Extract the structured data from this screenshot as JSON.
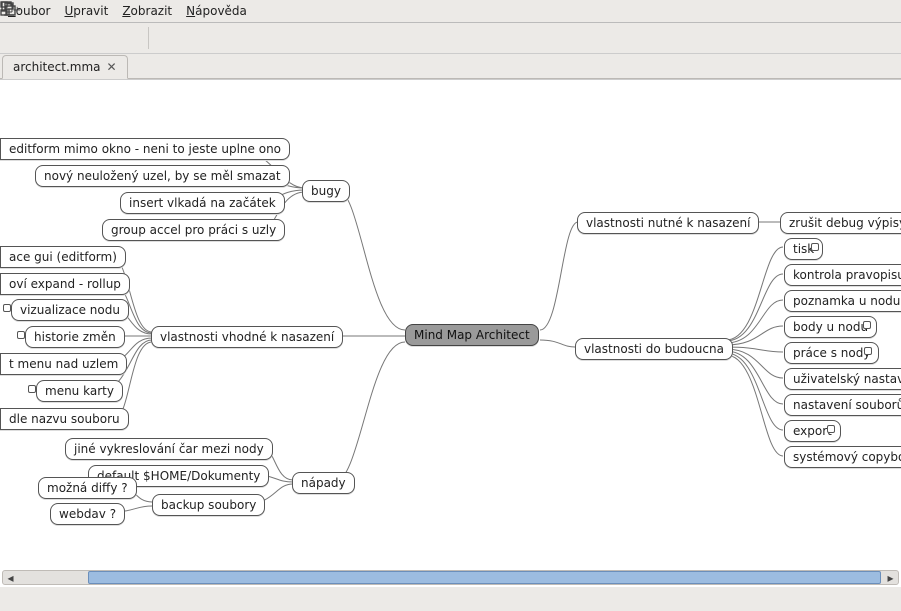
{
  "menu": {
    "file": "Soubor",
    "edit": "Upravit",
    "view": "Zobrazit",
    "help": "Nápověda"
  },
  "tab": {
    "title": "architect.mma",
    "close": "✕"
  },
  "nodes": {
    "root": "Mind Map Architect",
    "bugy": "bugy",
    "bugy_children": [
      "editform mimo okno - neni to jeste uplne ono",
      "nový neuložený uzel, by se měl smazat",
      "insert vlkadá na začátek",
      "group accel pro práci s uzly"
    ],
    "vhodne": "vlastnosti vhodné k nasazení",
    "vhodne_children": [
      "ace gui (editform)",
      "oví expand - rollup",
      "vizualizace nodu",
      "historie změn",
      "t menu nad uzlem",
      "menu karty",
      "dle nazvu souboru"
    ],
    "napady": "nápady",
    "napady_children": [
      "jiné vykreslování čar mezi nody",
      "default $HOME/Dokumenty",
      "backup soubory"
    ],
    "backup_children": [
      "možná diffy ?",
      "webdav ?"
    ],
    "nutne": "vlastnosti nutné k nasazení",
    "nutne_children": [
      "zrušit debug výpisy"
    ],
    "budoucna": "vlastnosti do budoucna",
    "budoucna_children": [
      "tisk",
      "kontrola pravopisu",
      "poznamka u nodu",
      "body u nodu",
      "práce s nody",
      "uživatelský nastavení",
      "nastavení souborů",
      "export",
      "systémový copyboard"
    ]
  }
}
